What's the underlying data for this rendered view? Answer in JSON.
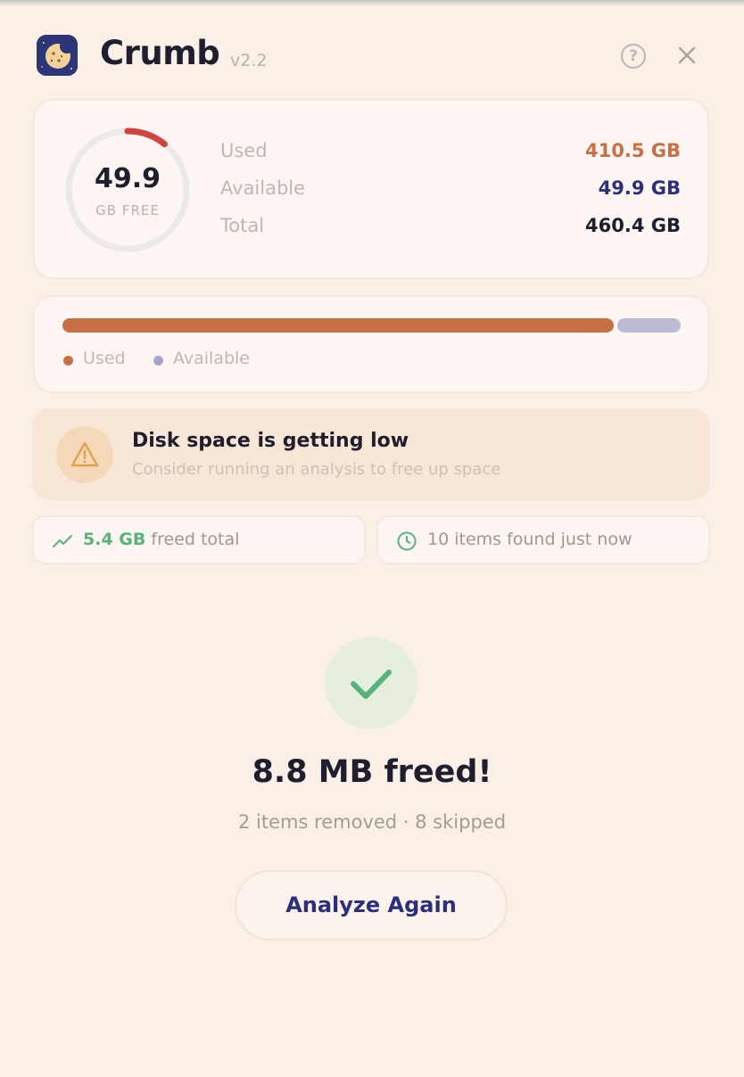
{
  "app": {
    "name": "Crumb",
    "version": "v2.2",
    "help_icon_label": "?"
  },
  "storage": {
    "free_value": "49.9",
    "free_label": "GB FREE",
    "used_fraction": 0.892,
    "stats": [
      {
        "label": "Used",
        "value": "410.5 GB",
        "color": "#c96f45"
      },
      {
        "label": "Available",
        "value": "49.9 GB",
        "color": "#2d2f7c"
      },
      {
        "label": "Total",
        "value": "460.4 GB",
        "color": "#1f1e2e"
      }
    ]
  },
  "usage_bar": {
    "used_fraction": 0.892,
    "legend": [
      {
        "label": "Used",
        "color": "#c96f45"
      },
      {
        "label": "Available",
        "color": "#a8a6c8"
      }
    ]
  },
  "warning": {
    "title": "Disk space is getting low",
    "subtitle": "Consider running an analysis to free up space",
    "icon": "warning-triangle-icon"
  },
  "pills": {
    "freed_amount": "5.4 GB",
    "freed_suffix": "freed total",
    "found_text": "10 items found just now"
  },
  "result": {
    "title": "8.8 MB freed!",
    "subtitle": "2 items removed · 8 skipped",
    "button_label": "Analyze Again"
  },
  "colors": {
    "background": "#faf0e7",
    "accent_used": "#c96f45",
    "accent_available": "#bdbad4",
    "success": "#58b37a",
    "ring_danger": "#d1443f",
    "brand_navy": "#2c3578"
  }
}
